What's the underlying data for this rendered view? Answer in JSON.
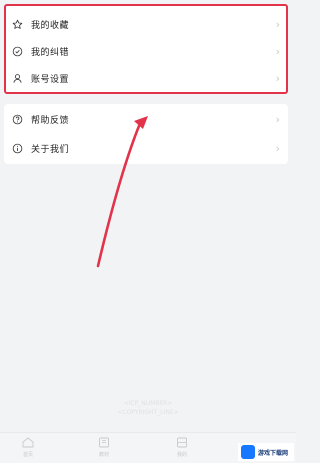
{
  "menu_group_1": {
    "items": [
      {
        "label": "我的收藏",
        "icon": "star-icon"
      },
      {
        "label": "我的纠错",
        "icon": "correction-circle-icon"
      },
      {
        "label": "账号设置",
        "icon": "user-icon"
      }
    ]
  },
  "menu_group_2": {
    "items": [
      {
        "label": "帮助反馈",
        "icon": "help-icon"
      },
      {
        "label": "关于我们",
        "icon": "info-icon"
      }
    ]
  },
  "footer": {
    "line1": "<ICP_NUMBER>",
    "line2": "<COPYRIGHT_LINE>"
  },
  "tabs": [
    {
      "label": "首页",
      "icon": "home-icon"
    },
    {
      "label": "教材",
      "icon": "book-icon"
    },
    {
      "label": "我的",
      "icon": "profile-card-icon"
    }
  ],
  "watermark": {
    "text": "游戏下载网"
  },
  "colors": {
    "highlight": "#e2334a",
    "accent": "#1677ff"
  }
}
